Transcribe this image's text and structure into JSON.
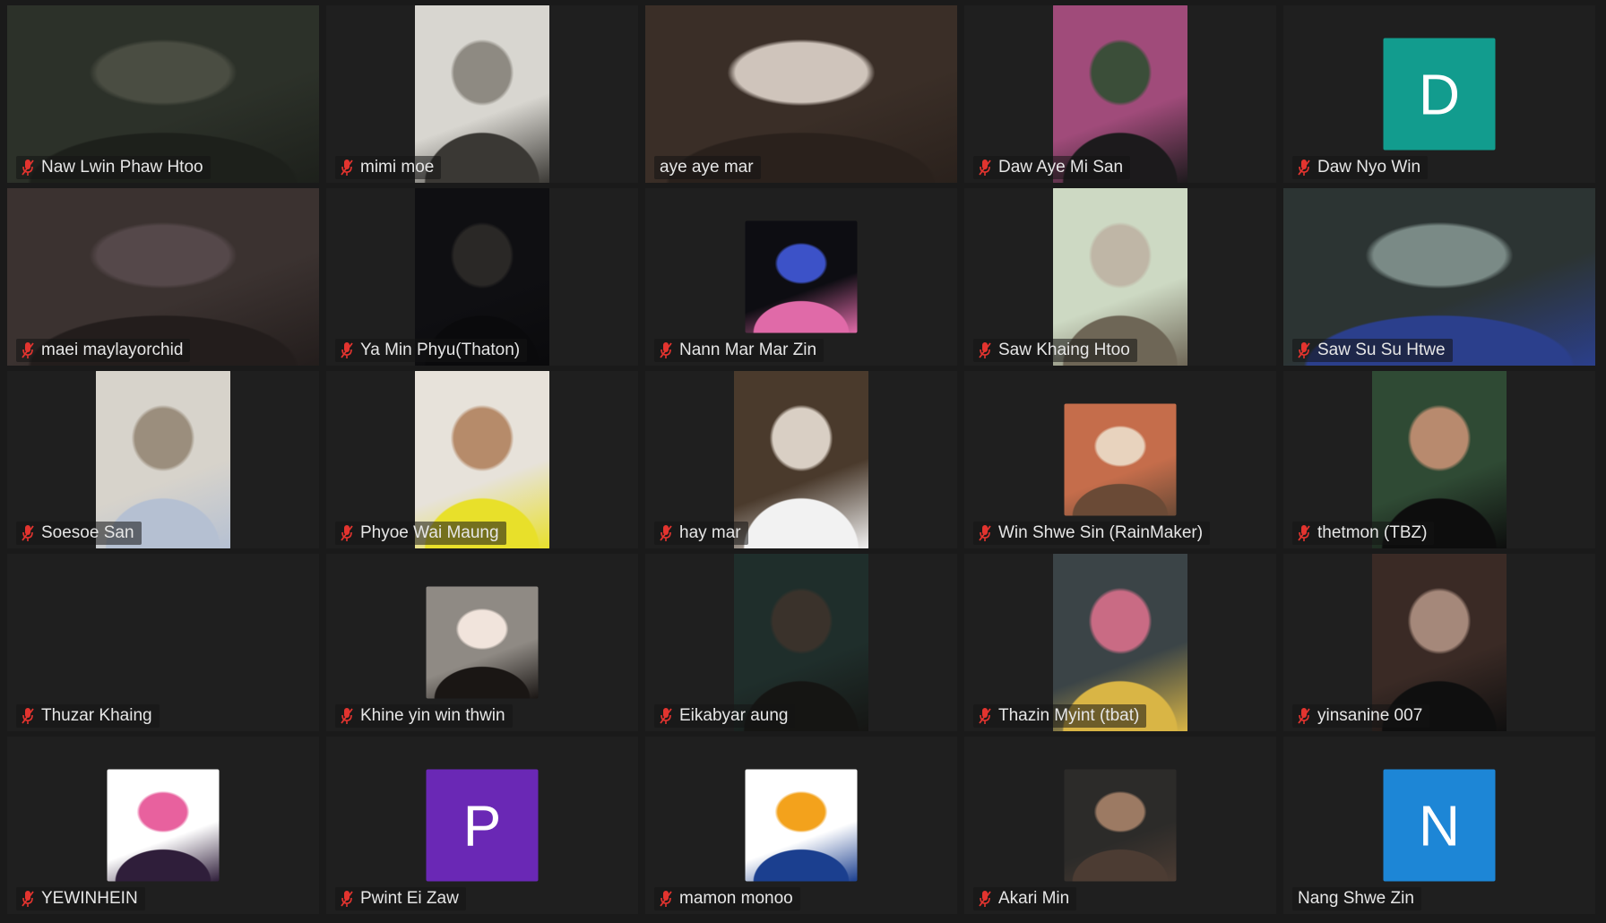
{
  "participants": [
    {
      "name": "Naw Lwin Phaw Htoo",
      "muted": true,
      "active": false,
      "media": "video",
      "kind": "wide",
      "colors": [
        "#2c3129",
        "#4a4d42",
        "#1d201b"
      ]
    },
    {
      "name": "mimi moe",
      "muted": true,
      "active": false,
      "media": "video",
      "kind": "video",
      "colors": [
        "#d8d6d0",
        "#8e8a82",
        "#3a3834"
      ]
    },
    {
      "name": "aye aye mar",
      "muted": false,
      "active": true,
      "media": "video",
      "kind": "wide",
      "colors": [
        "#3a2e27",
        "#cfc4bb",
        "#2a211c"
      ]
    },
    {
      "name": "Daw Aye Mi San",
      "muted": true,
      "active": false,
      "media": "video",
      "kind": "video",
      "colors": [
        "#a04b7a",
        "#3b4e39",
        "#1c1a1c"
      ]
    },
    {
      "name": "Daw Nyo Win",
      "muted": true,
      "active": false,
      "media": "avatar",
      "kind": "square",
      "letter": "D",
      "colors": [
        "#129c8e"
      ]
    },
    {
      "name": "maei maylayorchid",
      "muted": true,
      "active": false,
      "media": "video",
      "kind": "wide",
      "colors": [
        "#3b3230",
        "#55484a",
        "#231d1c"
      ]
    },
    {
      "name": "Ya Min Phyu(Thaton)",
      "muted": true,
      "active": false,
      "media": "video",
      "kind": "video",
      "colors": [
        "#0f0f12",
        "#2a2826",
        "#0a0a0c"
      ]
    },
    {
      "name": "Nann Mar Mar Zin",
      "muted": true,
      "active": false,
      "media": "picture",
      "kind": "square",
      "colors": [
        "#0d0d12",
        "#3c52c8",
        "#e06aa8"
      ]
    },
    {
      "name": "Saw Khaing Htoo",
      "muted": true,
      "active": false,
      "media": "video",
      "kind": "video",
      "colors": [
        "#cdd9c3",
        "#bfb6a6",
        "#6e6656"
      ]
    },
    {
      "name": "Saw Su Su Htwe",
      "muted": true,
      "active": false,
      "media": "video",
      "kind": "wide",
      "colors": [
        "#2c3433",
        "#7a8a86",
        "#2b3f8c"
      ]
    },
    {
      "name": "Soesoe San",
      "muted": true,
      "active": false,
      "media": "video",
      "kind": "video",
      "colors": [
        "#d7d3cb",
        "#9b8e7d",
        "#b5c0d2"
      ]
    },
    {
      "name": "Phyoe Wai Maung",
      "muted": true,
      "active": false,
      "media": "video",
      "kind": "video",
      "colors": [
        "#e7e2da",
        "#b68b6a",
        "#e8e02a"
      ]
    },
    {
      "name": "hay mar",
      "muted": true,
      "active": false,
      "media": "video",
      "kind": "video",
      "colors": [
        "#4a3a2c",
        "#d9cfc4",
        "#f2f2f2"
      ]
    },
    {
      "name": "Win Shwe Sin (RainMaker)",
      "muted": true,
      "active": false,
      "media": "picture",
      "kind": "square",
      "colors": [
        "#c56d4b",
        "#e8d3be",
        "#6a4a36"
      ]
    },
    {
      "name": "thetmon (TBZ)",
      "muted": true,
      "active": false,
      "media": "video",
      "kind": "video",
      "colors": [
        "#2f4a34",
        "#b88a6e",
        "#0d0d0d"
      ]
    },
    {
      "name": "Thuzar Khaing",
      "muted": true,
      "active": false,
      "media": "none",
      "kind": "none",
      "colors": []
    },
    {
      "name": "Khine yin win thwin",
      "muted": true,
      "active": false,
      "media": "picture",
      "kind": "square",
      "colors": [
        "#8f8a84",
        "#f1e4dc",
        "#1a1614"
      ]
    },
    {
      "name": "Eikabyar aung",
      "muted": true,
      "active": false,
      "media": "video",
      "kind": "video",
      "colors": [
        "#1f2e2b",
        "#3a322b",
        "#151513"
      ]
    },
    {
      "name": "Thazin Myint (tbat)",
      "muted": true,
      "active": false,
      "media": "video",
      "kind": "video",
      "colors": [
        "#3b4447",
        "#c96b84",
        "#d9b545"
      ]
    },
    {
      "name": "yinsanine 007",
      "muted": true,
      "active": false,
      "media": "video",
      "kind": "video",
      "colors": [
        "#3a2a25",
        "#a5887a",
        "#0f0f0f"
      ]
    },
    {
      "name": "YEWINHEIN",
      "muted": true,
      "active": false,
      "media": "picture",
      "kind": "square",
      "colors": [
        "#ffffff",
        "#e8619e",
        "#2f1e3a"
      ]
    },
    {
      "name": "Pwint Ei Zaw",
      "muted": true,
      "active": false,
      "media": "avatar",
      "kind": "square",
      "letter": "P",
      "colors": [
        "#6a28b5"
      ]
    },
    {
      "name": "mamon monoo",
      "muted": true,
      "active": false,
      "media": "picture",
      "kind": "square",
      "colors": [
        "#ffffff",
        "#f3a21c",
        "#1b3f8f"
      ]
    },
    {
      "name": "Akari Min",
      "muted": true,
      "active": false,
      "media": "picture",
      "kind": "square",
      "colors": [
        "#2c2b29",
        "#9c7a63",
        "#4c3c33"
      ]
    },
    {
      "name": "Nang Shwe Zin",
      "muted": false,
      "active": false,
      "media": "avatar",
      "kind": "square",
      "letter": "N",
      "colors": [
        "#1d86d6"
      ]
    }
  ],
  "icons": {
    "muted": "mic-muted-icon"
  },
  "theme": {
    "background": "#1a1a1a",
    "tile": "#1f1f1f",
    "active_border": "#dfe86a",
    "muted_icon": "#e3342f"
  }
}
